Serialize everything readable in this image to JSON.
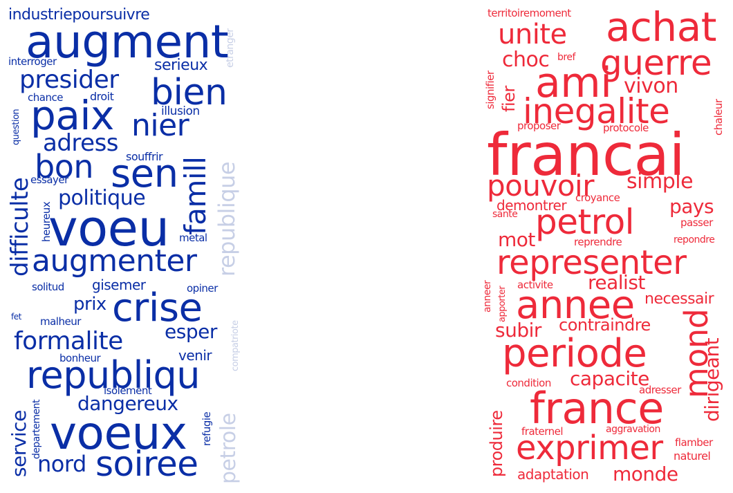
{
  "left_cloud": {
    "colors": {
      "main": "#0a2ea6",
      "light": "#c7cfe6"
    },
    "words": {
      "industriepoursuivre": "industriepoursuivre",
      "augment": "augment",
      "etranger": "etranger",
      "interroger": "interroger",
      "presider": "presider",
      "serieux": "serieux",
      "bien": "bien",
      "chance": "chance",
      "droit": "droit",
      "question": "question",
      "paix": "paix",
      "illusion": "illusion",
      "nier": "nier",
      "adress": "adress",
      "difficulte": "difficulte",
      "bon": "bon",
      "souffrir": "souffrir",
      "sen": "sen",
      "essayer": "essayer",
      "famill": "famill",
      "republique": "republique",
      "heureux": "heureux",
      "politique": "politique",
      "voeu": "voeu",
      "metal": "metal",
      "augmenter": "augmenter",
      "solitud": "solitud",
      "gisemer": "gisemer",
      "opiner": "opiner",
      "prix": "prix",
      "crise": "crise",
      "compatriote": "compatriote",
      "fet": "fet",
      "malheur": "malheur",
      "esper": "esper",
      "formalite": "formalite",
      "bonheur": "bonheur",
      "venir": "venir",
      "republiqu": "republiqu",
      "isolement": "isolement",
      "departement": "departement",
      "refugie": "refugie",
      "dangereux": "dangereux",
      "service": "service",
      "voeux": "voeux",
      "petrole": "petrole",
      "nord": "nord",
      "soiree": "soiree"
    }
  },
  "right_cloud": {
    "colors": {
      "main": "#ee2a3a"
    },
    "words": {
      "territoiremoment": "territoiremoment",
      "achat": "achat",
      "unite": "unite",
      "guerre": "guerre",
      "choc": "choc",
      "bref": "bref",
      "signifier": "signifier",
      "ami": "ami",
      "vivon": "vivon",
      "fier": "fier",
      "inegalite": "inegalite",
      "chaleur": "chaleur",
      "proposer": "proposer",
      "protocole": "protocole",
      "francai": "francai",
      "pouvoir": "pouvoir",
      "simple": "simple",
      "demontrer": "demontrer",
      "croyance": "croyance",
      "pays": "pays",
      "sante": "sante",
      "petrol": "petrol",
      "passer": "passer",
      "mot": "mot",
      "reprendre": "reprendre",
      "repondre": "repondre",
      "representer": "representer",
      "realist": "realist",
      "anneer": "anneer",
      "apporter": "apporter",
      "activite": "activite",
      "necessair": "necessair",
      "annee": "annee",
      "mond": "mond",
      "subir": "subir",
      "contraindre": "contraindre",
      "dirigeant": "dirigeant",
      "periode": "periode",
      "capacite": "capacite",
      "condition": "condition",
      "adresser": "adresser",
      "produire": "produire",
      "france": "france",
      "fraternel": "fraternel",
      "aggravation": "aggravation",
      "exprimer": "exprimer",
      "flamber": "flamber",
      "naturel": "naturel",
      "adaptation": "adaptation",
      "monde": "monde"
    }
  }
}
